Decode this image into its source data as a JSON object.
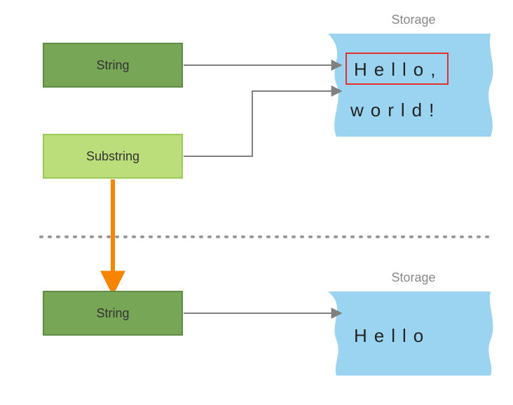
{
  "colors": {
    "string_box_fill": "#77A756",
    "string_box_stroke": "#5E8C44",
    "substring_box_fill": "#BBDE7B",
    "substring_box_stroke": "#9CC95C",
    "storage_fill": "#9AD4F1",
    "storage_stroke": "#7DB8D9",
    "arrow_gray": "#808080",
    "arrow_orange": "#F78500",
    "highlight_stroke": "#E52F2F",
    "divider": "#999999",
    "storage_label": "#888888"
  },
  "top": {
    "string_box": {
      "label": "String"
    },
    "substring_box": {
      "label": "Substring"
    },
    "storage_label": "Storage",
    "storage_line1": "Hello,",
    "storage_line2": "world!",
    "highlighted_region": "Hello"
  },
  "bottom": {
    "string_box": {
      "label": "String"
    },
    "storage_label": "Storage",
    "storage_text": "Hello"
  }
}
